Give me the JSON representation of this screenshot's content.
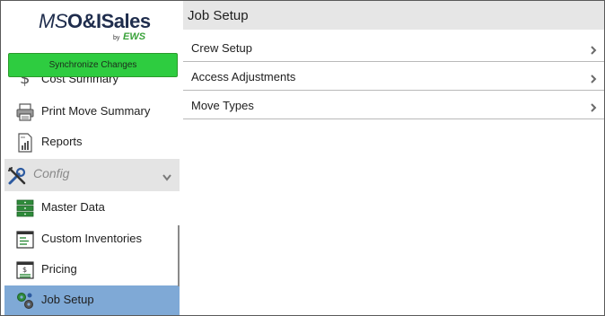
{
  "app": {
    "logo_prefix": "MS",
    "logo_main": "O&ISales",
    "logo_by": "by",
    "logo_brand": "EWS"
  },
  "sidebar": {
    "sync_label": "Synchronize Changes",
    "partial_item": {
      "label": "Cost Summary",
      "icon": "dollar-icon"
    },
    "items": [
      {
        "label": "Print Move Summary",
        "icon": "printer-icon",
        "active": false
      },
      {
        "label": "Reports",
        "icon": "report-chart-icon",
        "active": false
      }
    ],
    "section": {
      "label": "Config",
      "icon": "tools-icon",
      "expanded": true
    },
    "config_items": [
      {
        "label": "Master Data",
        "icon": "database-icon",
        "active": false
      },
      {
        "label": "Custom Inventories",
        "icon": "inventory-list-icon",
        "active": false
      },
      {
        "label": "Pricing",
        "icon": "pricing-icon",
        "active": false
      },
      {
        "label": "Job Setup",
        "icon": "gears-icon",
        "active": true
      }
    ]
  },
  "main": {
    "title": "Job Setup",
    "rows": [
      {
        "label": "Crew Setup"
      },
      {
        "label": "Access Adjustments"
      },
      {
        "label": "Move Types"
      }
    ]
  },
  "colors": {
    "sync_button": "#2ecc40",
    "active_item": "#7fa9d6",
    "section_bg": "#e4e4e4",
    "header_bg": "#e6e6e6",
    "brand_green": "#3aa23a"
  }
}
